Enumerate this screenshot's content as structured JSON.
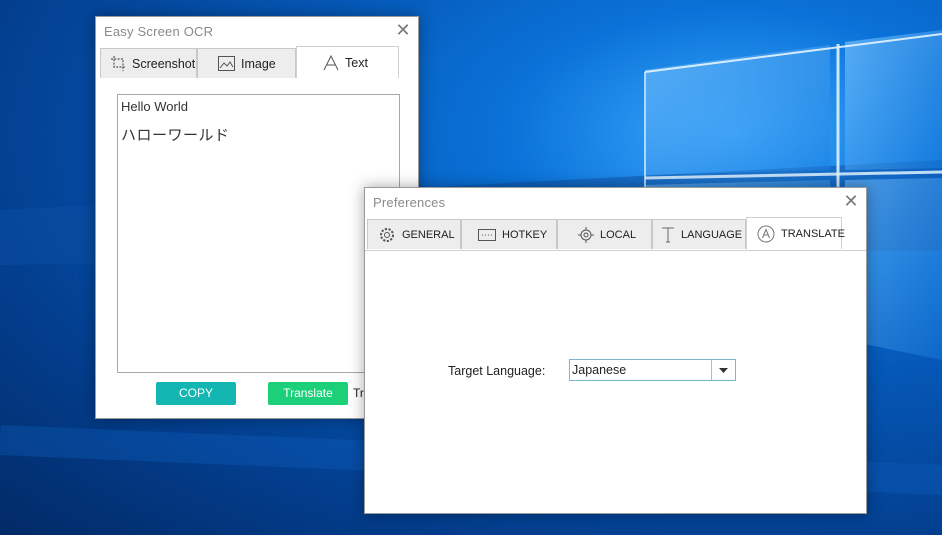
{
  "ocr_window": {
    "title": "Easy Screen OCR",
    "tabs": [
      {
        "label": "Screenshot",
        "icon": "crop-icon",
        "active": false
      },
      {
        "label": "Image",
        "icon": "image-icon",
        "active": false
      },
      {
        "label": "Text",
        "icon": "text-a-icon",
        "active": true
      }
    ],
    "text_lines": [
      "Hello World",
      "ハローワールド"
    ],
    "copy_label": "COPY",
    "translate_label": "Translate",
    "truncated_label": "Tr"
  },
  "prefs_window": {
    "title": "Preferences",
    "tabs": [
      {
        "label": "GENERAL",
        "icon": "gear-icon",
        "active": false
      },
      {
        "label": "HOTKEY",
        "icon": "keyboard-icon",
        "active": false
      },
      {
        "label": "LOCAL",
        "icon": "target-icon",
        "active": false
      },
      {
        "label": "LANGUAGE",
        "icon": "text-t-icon",
        "active": false
      },
      {
        "label": "TRANSLATE",
        "icon": "translate-a-icon",
        "active": true
      }
    ],
    "target_language_label": "Target Language:",
    "target_language_value": "Japanese"
  },
  "colors": {
    "copy_button": "#14b6b2",
    "translate_button": "#1cd07a",
    "desktop": "#0560c4"
  }
}
